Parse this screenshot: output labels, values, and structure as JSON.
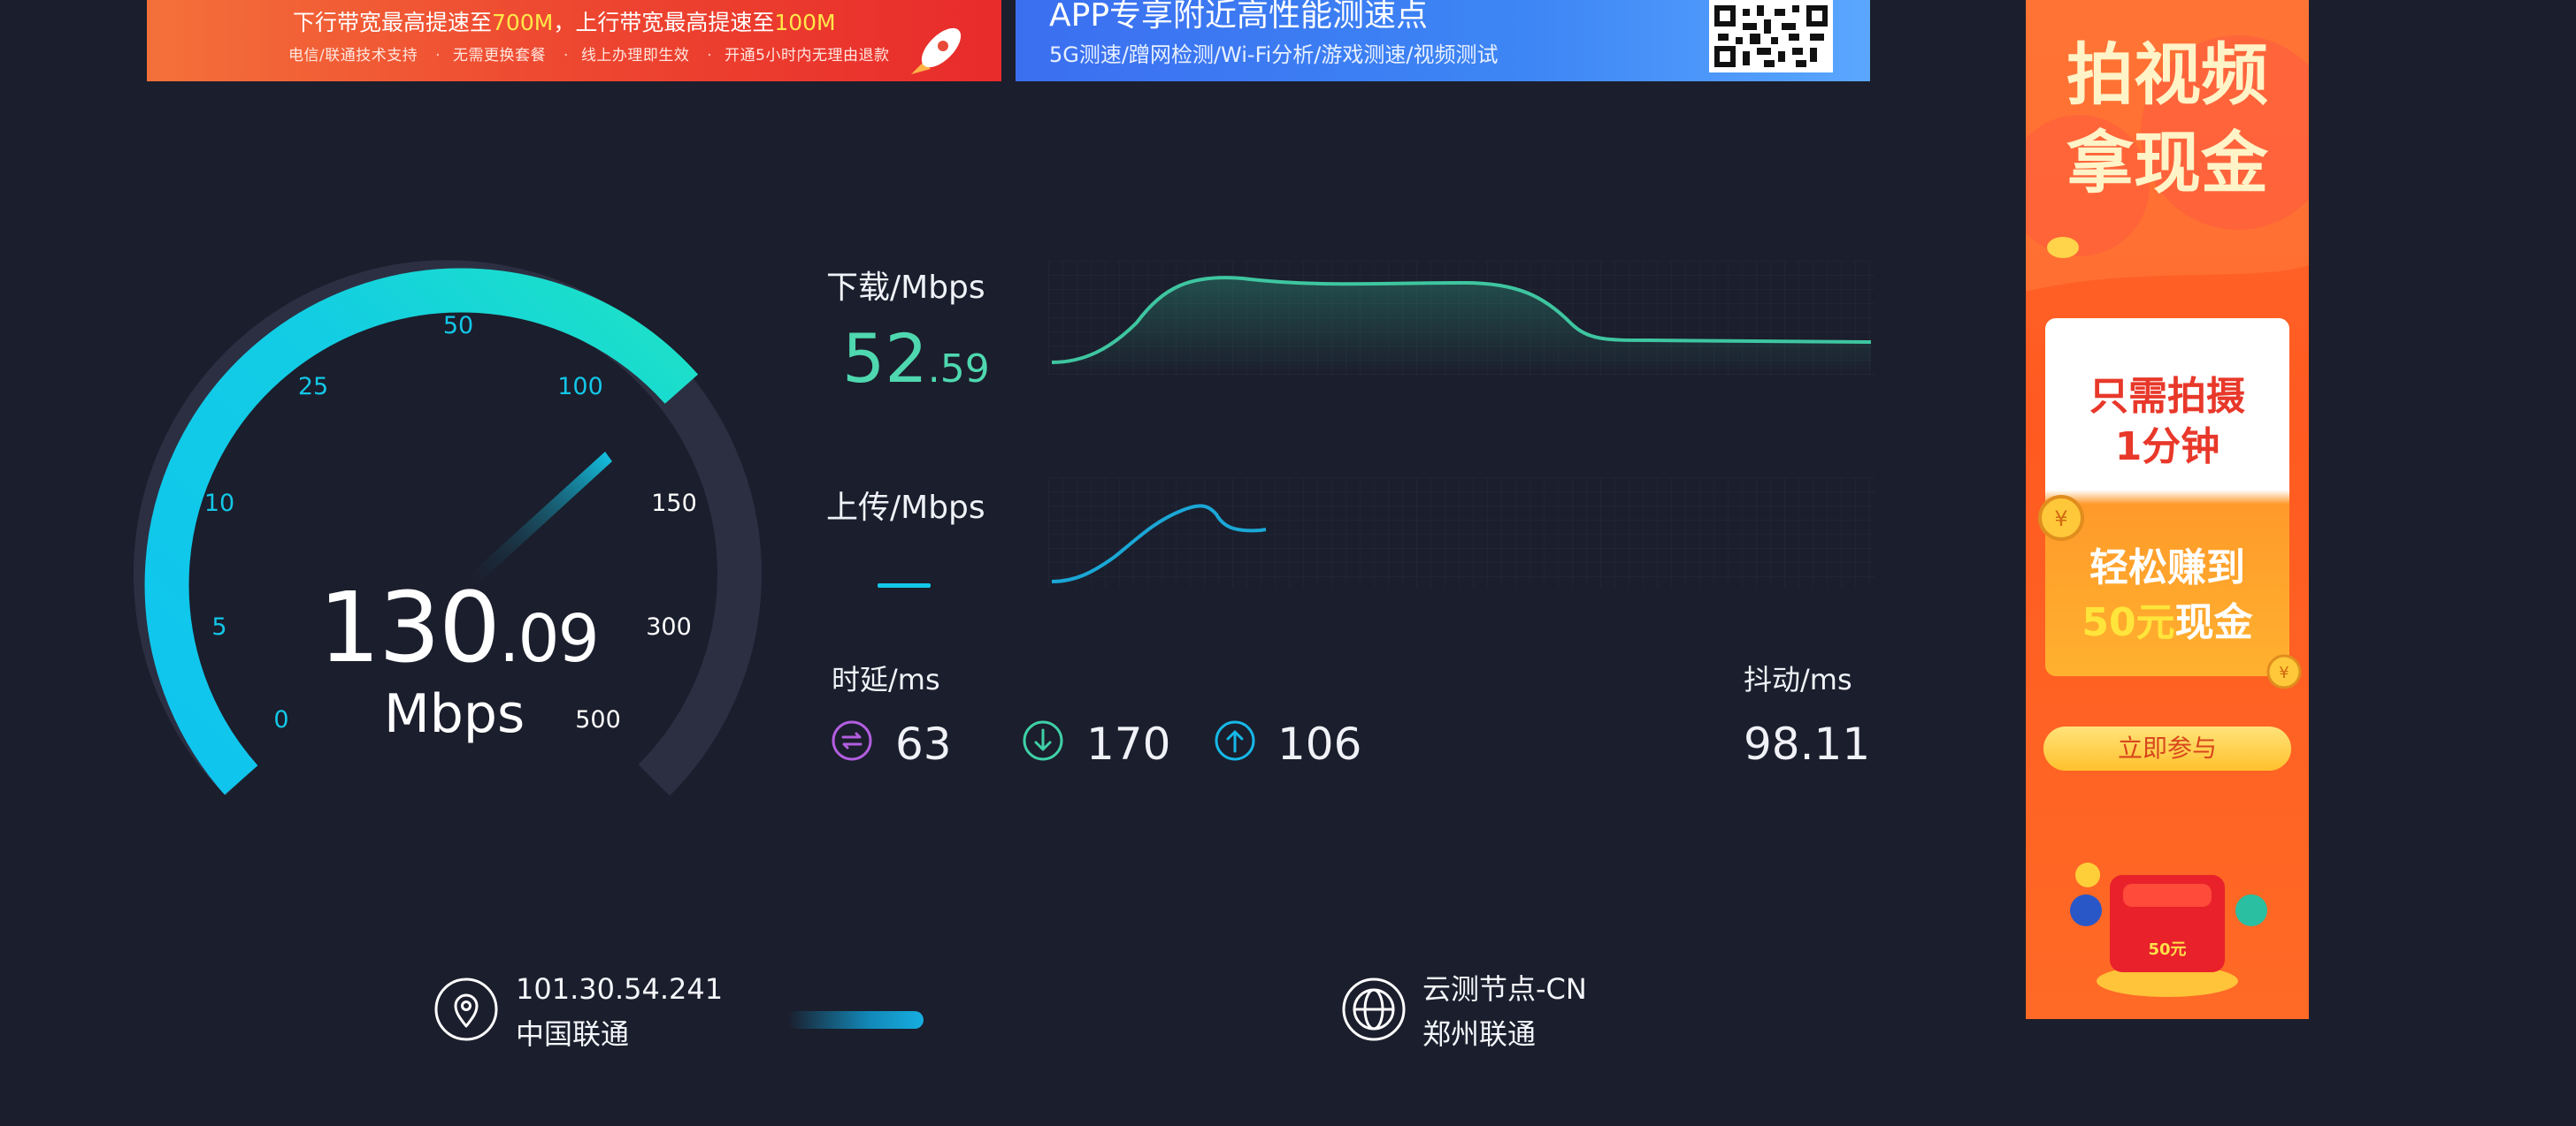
{
  "banners": {
    "left": {
      "line1_prefix": "下行带宽最高提速至",
      "line1_down": "700M",
      "line1_mid": "，上行带宽最高提速至",
      "line1_up": "100M",
      "bullets": [
        "电信/联通技术支持",
        "无需更换套餐",
        "线上办理即生效",
        "开通5小时内无理由退款"
      ]
    },
    "right": {
      "headline": "APP专享附近高性能测速点",
      "features": "5G测速/蹭网检测/Wi-Fi分析/游戏测速/视频测试"
    }
  },
  "gauge": {
    "ticks": [
      "0",
      "5",
      "10",
      "25",
      "50",
      "100",
      "150",
      "300",
      "500"
    ],
    "value_int": "130",
    "value_dec": ".09",
    "unit": "Mbps",
    "current_value": 130.09
  },
  "download": {
    "label": "下载/Mbps",
    "value_int": "52",
    "value_dec": ".59"
  },
  "upload": {
    "label": "上传/Mbps"
  },
  "latency": {
    "label": "时延/ms",
    "idle": "63",
    "down": "170",
    "up": "106"
  },
  "jitter": {
    "label": "抖动/ms",
    "value": "98.11"
  },
  "client": {
    "ip": "101.30.54.241",
    "isp": "中国联通"
  },
  "server": {
    "name": "云测节点-CN",
    "isp": "郑州联通"
  },
  "ad": {
    "title_line1": "拍视频",
    "title_line2": "拿现金",
    "card_line1": "只需拍摄",
    "card_line2": "1分钟",
    "card_line3": "轻松赚到",
    "card_amount": "50元",
    "card_suffix": "现金",
    "coin_label": "50元",
    "button": "立即参与"
  },
  "colors": {
    "background": "#1b1e2c",
    "gauge_arc": "#13c7e8",
    "download": "#4fd8b0",
    "upload": "#13c7e8",
    "latency_idle": "#b25ee0",
    "latency_down": "#3fd0a8",
    "latency_up": "#16b8e8"
  }
}
